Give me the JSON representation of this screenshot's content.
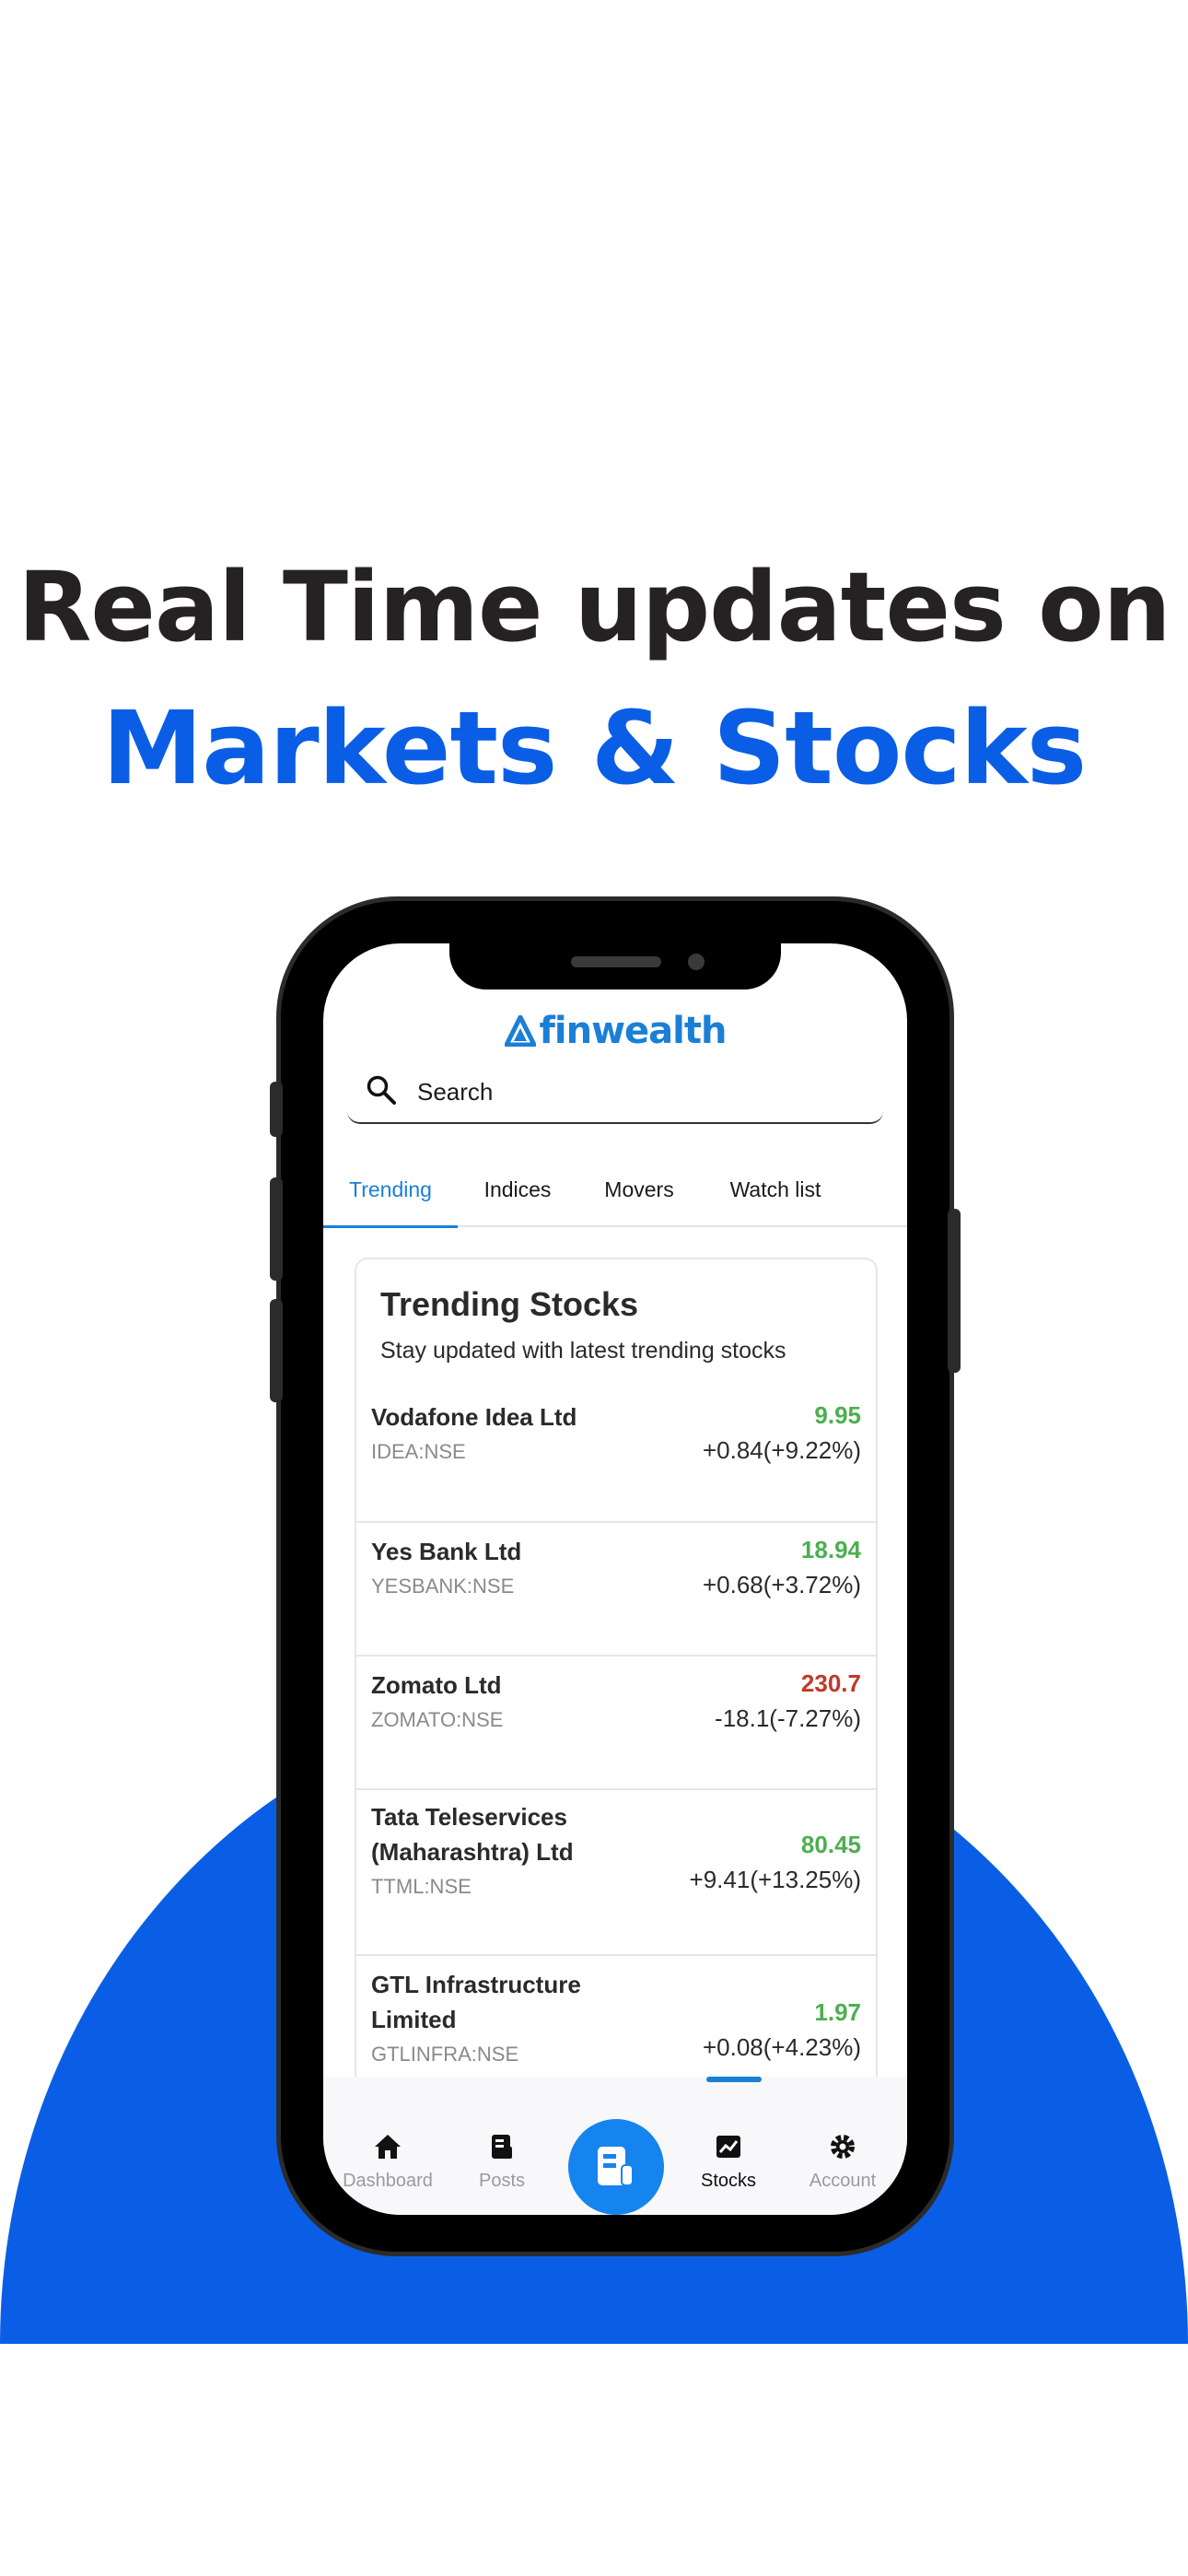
{
  "headline": {
    "line1": "Real Time updates on",
    "line2": "Markets & Stocks"
  },
  "app": {
    "logo_text": "finwealth",
    "search": {
      "placeholder": "Search",
      "value": ""
    },
    "tabs": [
      {
        "label": "Trending",
        "active": true
      },
      {
        "label": "Indices",
        "active": false
      },
      {
        "label": "Movers",
        "active": false
      },
      {
        "label": "Watch list",
        "active": false
      }
    ],
    "card": {
      "title": "Trending Stocks",
      "subtitle": "Stay updated with latest trending stocks",
      "stocks": [
        {
          "name_line1": "Vodafone Idea Ltd",
          "name_line2": "",
          "symbol": "IDEA:NSE",
          "price": "9.95",
          "change": "+0.84(+9.22%)",
          "direction": "up"
        },
        {
          "name_line1": "Yes Bank Ltd",
          "name_line2": "",
          "symbol": "YESBANK:NSE",
          "price": "18.94",
          "change": "+0.68(+3.72%)",
          "direction": "up"
        },
        {
          "name_line1": "Zomato Ltd",
          "name_line2": "",
          "symbol": "ZOMATO:NSE",
          "price": "230.7",
          "change": "-18.1(-7.27%)",
          "direction": "down"
        },
        {
          "name_line1": "Tata Teleservices",
          "name_line2": "(Maharashtra) Ltd",
          "symbol": "TTML:NSE",
          "price": "80.45",
          "change": "+9.41(+13.25%)",
          "direction": "up"
        },
        {
          "name_line1": "GTL Infrastructure",
          "name_line2": "Limited",
          "symbol": "GTLINFRA:NSE",
          "price": "1.97",
          "change": "+0.08(+4.23%)",
          "direction": "up"
        }
      ]
    },
    "nav": [
      {
        "label": "Dashboard",
        "icon": "home-icon",
        "active": false
      },
      {
        "label": "Posts",
        "icon": "posts-icon",
        "active": false
      },
      {
        "label": "",
        "icon": "news-icon",
        "active": false
      },
      {
        "label": "Stocks",
        "icon": "chart-icon",
        "active": true
      },
      {
        "label": "Account",
        "icon": "gear-icon",
        "active": false
      }
    ]
  },
  "colors": {
    "brand_blue": "#0a5ee6",
    "accent_blue": "#1a7fd6",
    "up_green": "#4caf50",
    "down_red": "#c0392b",
    "headline_dark": "#262223"
  }
}
